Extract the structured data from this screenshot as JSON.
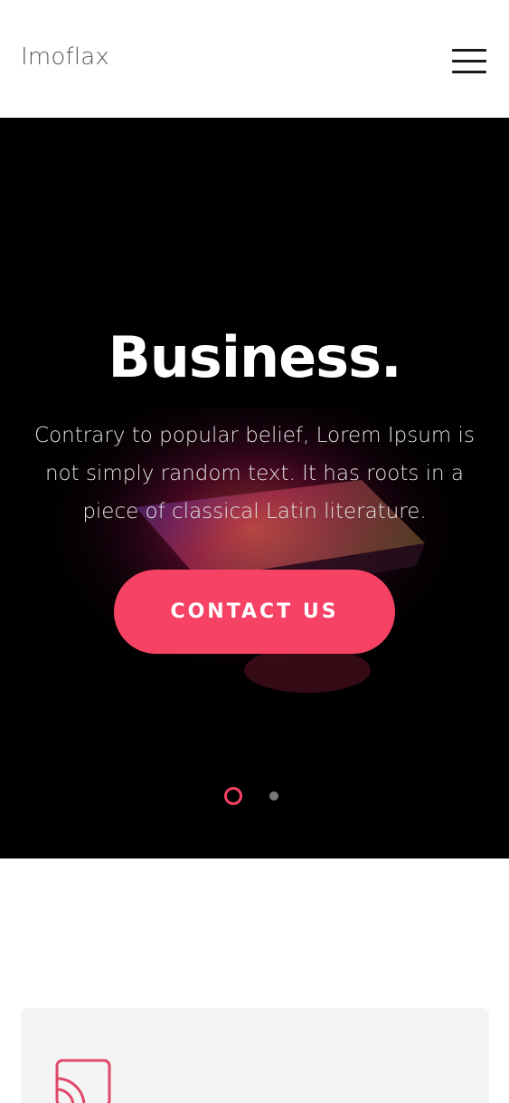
{
  "header": {
    "logo": "Imoflax",
    "menu_icon": "hamburger-menu-icon"
  },
  "hero": {
    "title": "Business.",
    "description": "Contrary to popular belief, Lorem Ipsum is not simply random text. It has roots in a piece of classical Latin literature.",
    "cta_label": "CONTACT US",
    "slides": {
      "count": 2,
      "active": 1
    }
  },
  "features": {
    "first_icon": "cast-icon"
  },
  "colors": {
    "accent": "#f54265",
    "hero_bg": "#000000",
    "card_bg": "#f4f4f4"
  }
}
